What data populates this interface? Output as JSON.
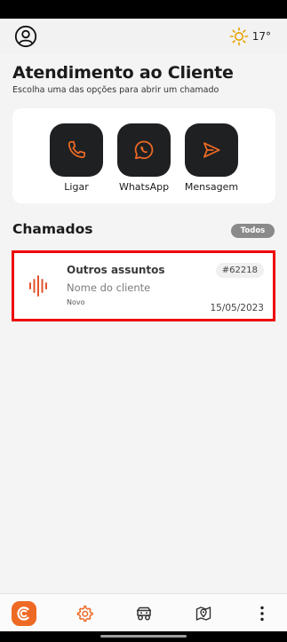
{
  "header": {
    "weather_temp": "17°",
    "icons": {
      "profile": "user-circle-icon",
      "weather": "sun-icon"
    }
  },
  "page": {
    "title": "Atendimento ao Cliente",
    "subtitle": "Escolha uma das opções para abrir um chamado"
  },
  "actions": [
    {
      "label": "Ligar",
      "icon": "phone-icon"
    },
    {
      "label": "WhatsApp",
      "icon": "whatsapp-icon"
    },
    {
      "label": "Mensagem",
      "icon": "send-icon"
    }
  ],
  "tickets_section": {
    "title": "Chamados",
    "filter_label": "Todos"
  },
  "tickets": [
    {
      "title": "Outros assuntos",
      "client": "Nome do cliente",
      "status": "Novo",
      "id": "#62218",
      "date": "15/05/2023",
      "icon": "audio-waveform-icon"
    }
  ],
  "bottom_nav": {
    "items": [
      "home-logo-icon",
      "gear-settings-icon",
      "vehicle-icon",
      "map-pin-icon",
      "more-vertical-icon"
    ]
  },
  "colors": {
    "accent": "#ee6a24",
    "tile_bg": "#1f2022",
    "highlight_border": "#ee0000",
    "chip_bg": "#8a8a8a"
  }
}
